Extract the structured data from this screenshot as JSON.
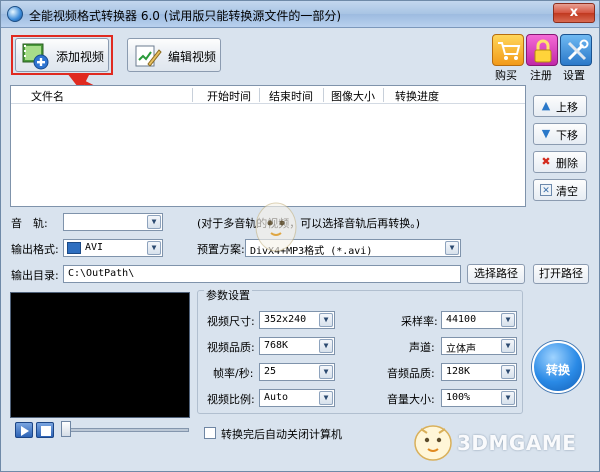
{
  "window": {
    "title": "全能视频格式转换器 6.0 (试用版只能转换源文件的一部分)",
    "close_label": "x"
  },
  "toolbar": {
    "add_video": "添加视频",
    "edit_video": "编辑视频"
  },
  "right_toolbar": {
    "buy": "购买",
    "register": "注册",
    "settings": "设置"
  },
  "file_list": {
    "columns": [
      "文件名",
      "开始时间",
      "结束时间",
      "图像大小",
      "转换进度"
    ]
  },
  "side_buttons": {
    "move_up": "上移",
    "move_down": "下移",
    "delete": "删除",
    "clear": "清空"
  },
  "audio_track": {
    "label": "音　轨:",
    "value": "",
    "hint": "(对于多音轨的视频，可以选择音轨后再转换。)"
  },
  "output_format": {
    "label": "输出格式:",
    "value": "AVI"
  },
  "preset": {
    "label": "预置方案:",
    "value": "DivX4+MP3格式 (*.avi)"
  },
  "output_dir": {
    "label": "输出目录:",
    "value": "C:\\OutPath\\",
    "select_button": "选择路径",
    "open_button": "打开路径"
  },
  "params": {
    "title": "参数设置",
    "video_size": {
      "label": "视频尺寸:",
      "value": "352x240"
    },
    "video_quality": {
      "label": "视频品质:",
      "value": "768K"
    },
    "fps": {
      "label": "帧率/秒:",
      "value": "25"
    },
    "aspect": {
      "label": "视频比例:",
      "value": "Auto"
    },
    "sample_rate": {
      "label": "采样率:",
      "value": "44100"
    },
    "channel": {
      "label": "声道:",
      "value": "立体声"
    },
    "audio_quality": {
      "label": "音频品质:",
      "value": "128K"
    },
    "volume": {
      "label": "音量大小:",
      "value": "100%"
    }
  },
  "convert_button": "转换",
  "auto_shutdown": {
    "label": "转换完后自动关闭计算机",
    "checked": false
  },
  "player": {
    "slider_position": 0
  },
  "watermark": "3DMGAME",
  "colors": {
    "accent": "#e02a20",
    "window_bg": "#d9e3ee",
    "button_blue": "#2a8ae6"
  }
}
